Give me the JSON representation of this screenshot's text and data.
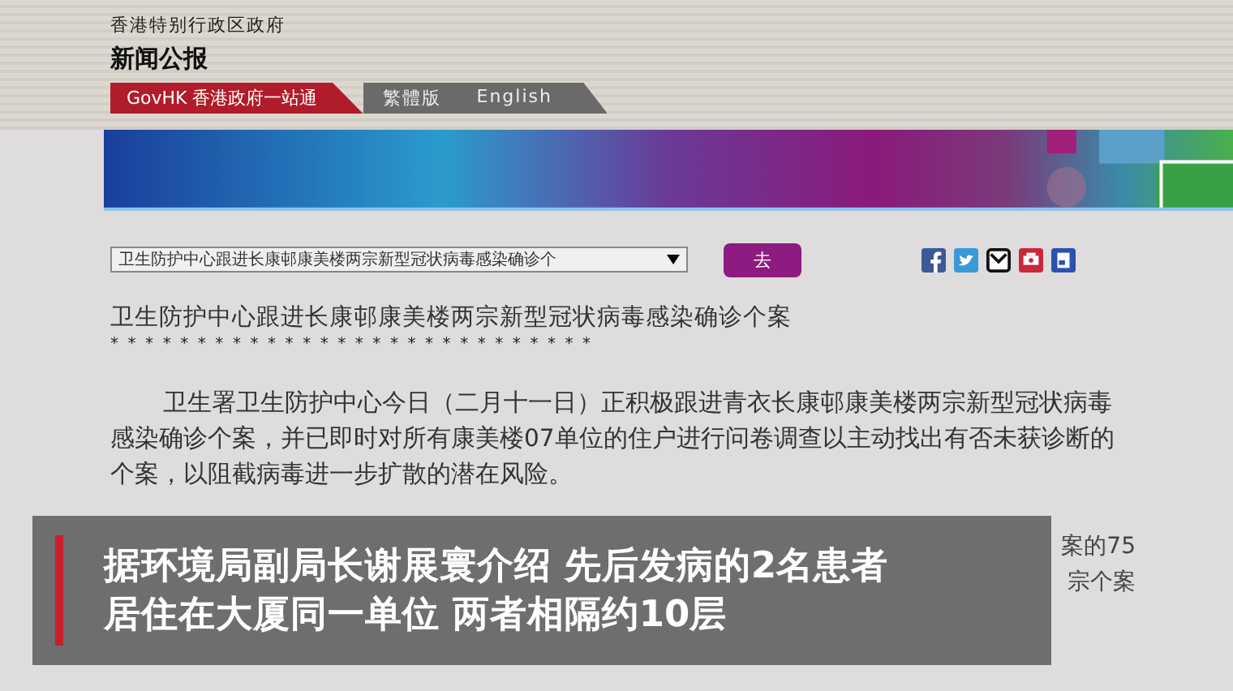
{
  "header": {
    "org": "香港特别行政区政府",
    "title": "新闻公报"
  },
  "nav": [
    {
      "label": "GovHK 香港政府一站通",
      "kind": "portal"
    },
    {
      "label": "繁體版",
      "kind": "link"
    },
    {
      "label": "English",
      "kind": "link"
    }
  ],
  "selector": {
    "value": "卫生防护中心跟进长康邨康美楼两宗新型冠状病毒感染确诊个",
    "button": "去"
  },
  "article": {
    "title": "卫生防护中心跟进长康邨康美楼两宗新型冠状病毒感染确诊个案",
    "separator": "* * * * * * * * * * * * * * * * * * * * * * * * * * * *",
    "paragraph": "卫生署卫生防护中心今日（二月十一日）正积极跟进青衣长康邨康美楼两宗新型冠状病毒感染确诊个案，并已即时对所有康美楼07单位的住户进行问卷调查以主动找出有否未获诊断的个案，以阻截病毒进一步扩散的潜在风险。",
    "partial_lines": [
      "案的75",
      "宗个案"
    ]
  },
  "caption": {
    "lines": [
      "据环境局副局长谢展寰介绍 先后发病的2名患者",
      "居住在大厦同一单位 两者相隔约10层"
    ]
  }
}
